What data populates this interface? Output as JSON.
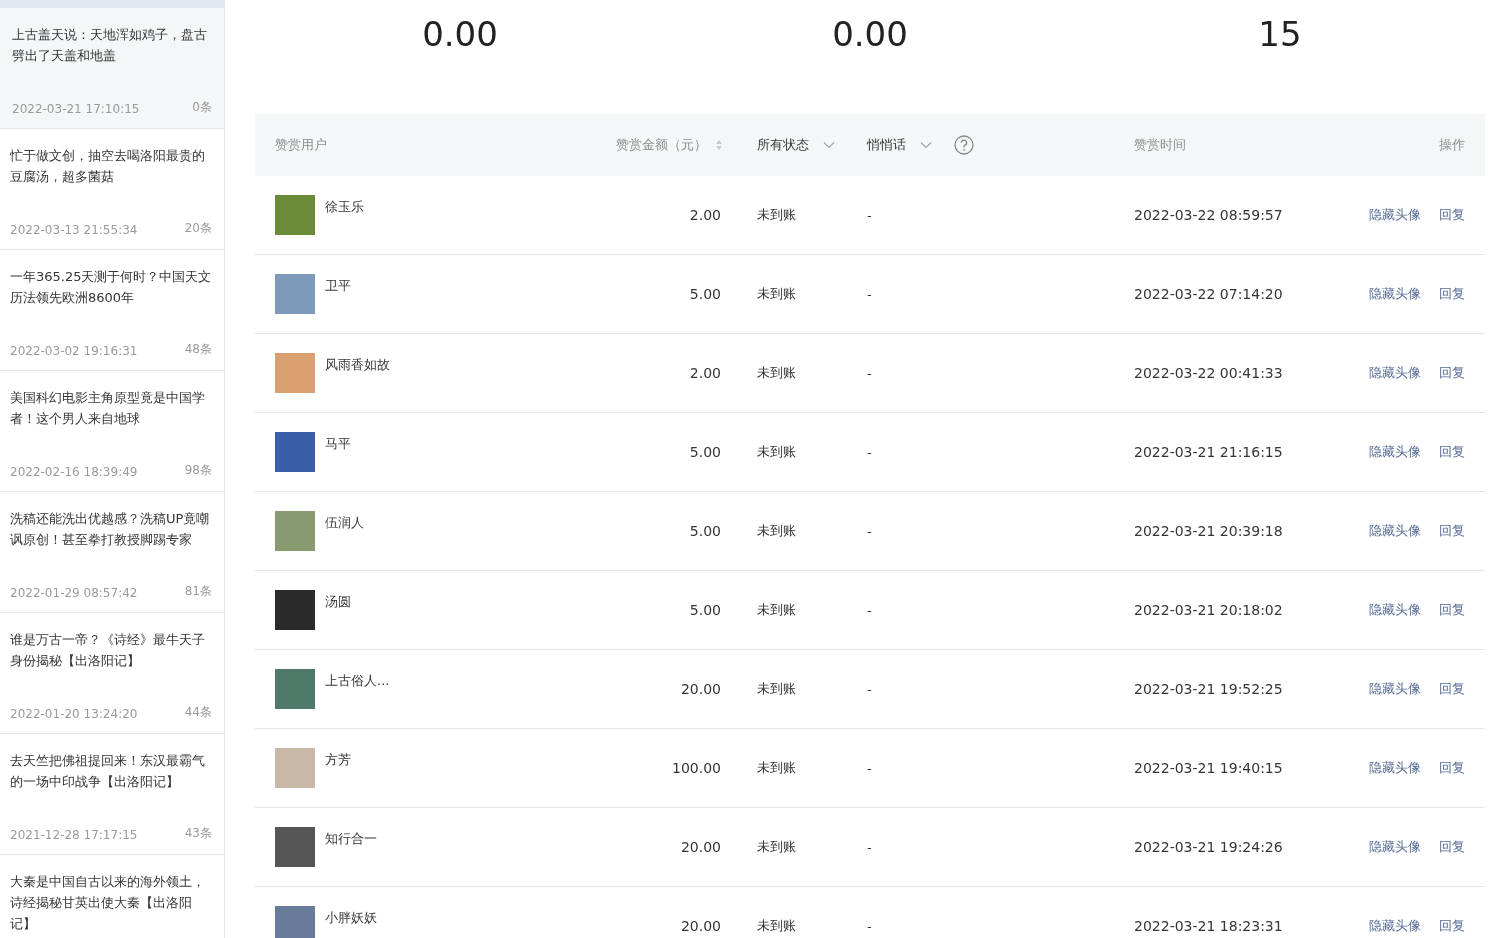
{
  "articles": [
    {
      "title": "上古盖天说：天地浑如鸡子，盘古劈出了天盖和地盖",
      "time": "2022-03-21 17:10:15",
      "count": "0条",
      "selected": true
    },
    {
      "title": "忙于做文创，抽空去喝洛阳最贵的豆腐汤，超多菌菇",
      "time": "2022-03-13 21:55:34",
      "count": "20条",
      "selected": false
    },
    {
      "title": "一年365.25天测于何时？中国天文历法领先欧洲8600年",
      "time": "2022-03-02 19:16:31",
      "count": "48条",
      "selected": false
    },
    {
      "title": "美国科幻电影主角原型竟是中国学者！这个男人来自地球",
      "time": "2022-02-16 18:39:49",
      "count": "98条",
      "selected": false
    },
    {
      "title": "洗稿还能洗出优越感？洗稿UP竟嘲讽原创！甚至拳打教授脚踢专家",
      "time": "2022-01-29 08:57:42",
      "count": "81条",
      "selected": false
    },
    {
      "title": "谁是万古一帝？《诗经》最牛天子身份揭秘【出洛阳记】",
      "time": "2022-01-20 13:24:20",
      "count": "44条",
      "selected": false
    },
    {
      "title": "去天竺把佛祖提回来！东汉最霸气的一场中印战争【出洛阳记】",
      "time": "2021-12-28 17:17:15",
      "count": "43条",
      "selected": false
    },
    {
      "title": "大秦是中国自古以来的海外领土，诗经揭秘甘英出使大秦【出洛阳记】",
      "selected": false
    }
  ],
  "stats": [
    "0.00",
    "0.00",
    "15"
  ],
  "table": {
    "columns": [
      {
        "label": "赞赏用户",
        "kind": "plain"
      },
      {
        "label": "赞赏金额（元）",
        "kind": "sort"
      },
      {
        "label": "所有状态",
        "kind": "filter"
      },
      {
        "label": "悄悄话",
        "kind": "filter-help"
      },
      {
        "label": "赞赏时间",
        "kind": "plain"
      },
      {
        "label": "操作",
        "kind": "plain"
      }
    ],
    "rows": [
      {
        "user": "徐玉乐",
        "amount": "2.00",
        "status": "未到账",
        "message": "-",
        "time": "2022-03-22 08:59:57",
        "actions": [
          "隐藏头像",
          "回复"
        ]
      },
      {
        "user": "卫平",
        "amount": "5.00",
        "status": "未到账",
        "message": "-",
        "time": "2022-03-22 07:14:20",
        "actions": [
          "隐藏头像",
          "回复"
        ]
      },
      {
        "user": "风雨香如故",
        "amount": "2.00",
        "status": "未到账",
        "message": "-",
        "time": "2022-03-22 00:41:33",
        "actions": [
          "隐藏头像",
          "回复"
        ]
      },
      {
        "user": "马平",
        "amount": "5.00",
        "status": "未到账",
        "message": "-",
        "time": "2022-03-21 21:16:15",
        "actions": [
          "隐藏头像",
          "回复"
        ]
      },
      {
        "user": "伍润人",
        "amount": "5.00",
        "status": "未到账",
        "message": "-",
        "time": "2022-03-21 20:39:18",
        "actions": [
          "隐藏头像",
          "回复"
        ]
      },
      {
        "user": "汤圆",
        "amount": "5.00",
        "status": "未到账",
        "message": "-",
        "time": "2022-03-21 20:18:02",
        "actions": [
          "隐藏头像",
          "回复"
        ]
      },
      {
        "user": "上古俗人...",
        "amount": "20.00",
        "status": "未到账",
        "message": "-",
        "time": "2022-03-21 19:52:25",
        "actions": [
          "隐藏头像",
          "回复"
        ]
      },
      {
        "user": "方芳",
        "amount": "100.00",
        "status": "未到账",
        "message": "-",
        "time": "2022-03-21 19:40:15",
        "actions": [
          "隐藏头像",
          "回复"
        ]
      },
      {
        "user": "知行合一",
        "amount": "20.00",
        "status": "未到账",
        "message": "-",
        "time": "2022-03-21 19:24:26",
        "actions": [
          "隐藏头像",
          "回复"
        ]
      },
      {
        "user": "小胖妖妖",
        "amount": "20.00",
        "status": "未到账",
        "message": "-",
        "time": "2022-03-21 18:23:31",
        "actions": [
          "隐藏头像",
          "回复"
        ]
      }
    ]
  }
}
